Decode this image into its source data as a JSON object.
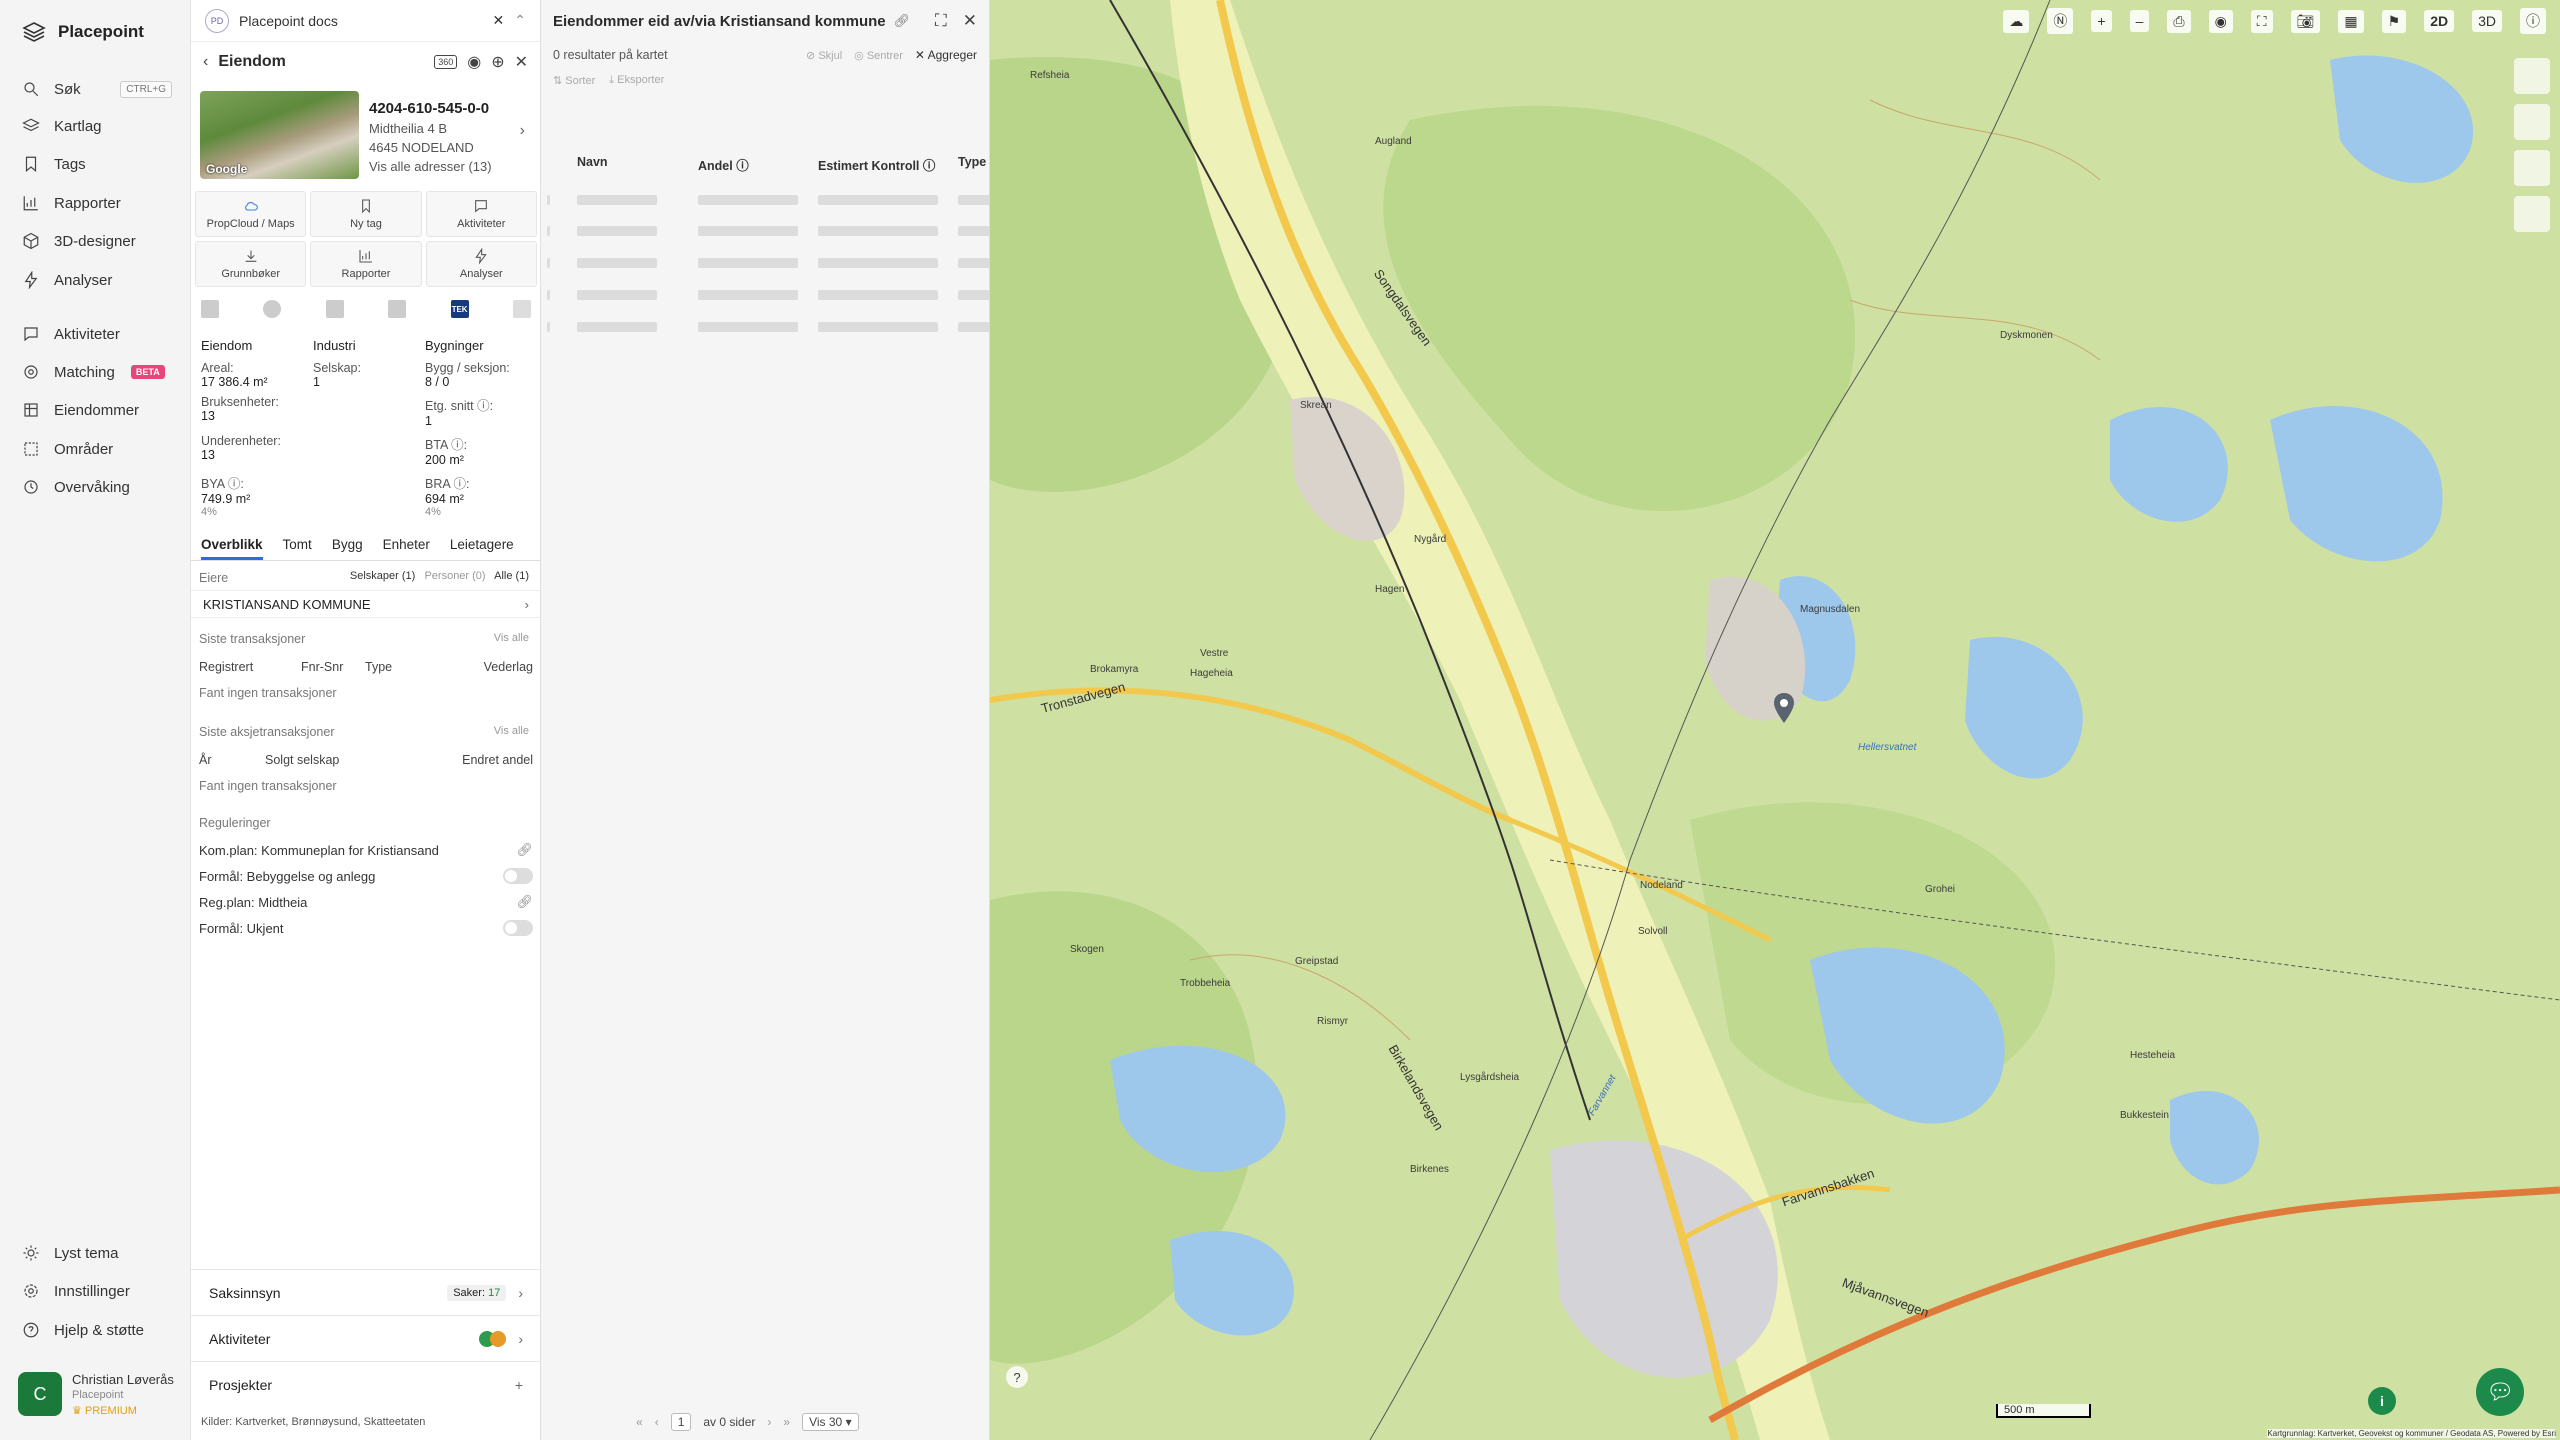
{
  "nav": {
    "brand": "Placepoint",
    "items": [
      {
        "label": "Søk",
        "icon": "search-icon",
        "kbd": "CTRL+G"
      },
      {
        "label": "Kartlag",
        "icon": "layers-icon"
      },
      {
        "label": "Tags",
        "icon": "bookmark-icon"
      },
      {
        "label": "Rapporter",
        "icon": "chart-icon"
      },
      {
        "label": "3D-designer",
        "icon": "cube-icon"
      },
      {
        "label": "Analyser",
        "icon": "bolt-icon"
      },
      {
        "label": "Aktiviteter",
        "icon": "chat-icon"
      },
      {
        "label": "Matching",
        "icon": "target-icon",
        "badge": "BETA"
      },
      {
        "label": "Eiendommer",
        "icon": "building-icon"
      },
      {
        "label": "Områder",
        "icon": "area-icon"
      },
      {
        "label": "Overvåking",
        "icon": "eye-icon"
      }
    ],
    "bottom": [
      {
        "label": "Lyst tema",
        "icon": "sun-icon"
      },
      {
        "label": "Innstillinger",
        "icon": "gear-icon"
      },
      {
        "label": "Hjelp & støtte",
        "icon": "help-icon"
      }
    ],
    "user": {
      "initial": "C",
      "name": "Christian Løverås",
      "org": "Placepoint",
      "plan": "PREMIUM"
    }
  },
  "doc": {
    "logo": "PD",
    "title": "Placepoint docs"
  },
  "property": {
    "header": "Eiendom",
    "header_badge": "360",
    "id": "4204-610-545-0-0",
    "street": "Midtheilia 4 B",
    "postal": "4645 NODELAND",
    "all_addresses": "Vis alle adresser (13)",
    "image_credit": "Google",
    "buttons": [
      "PropCloud / Maps",
      "Ny tag",
      "Aktiviteter",
      "Grunnbøker",
      "Rapporter",
      "Analyser"
    ],
    "tek_label": "TEK",
    "stats": {
      "col1_head": "Eiendom",
      "col2_head": "Industri",
      "col3_head": "Bygninger",
      "areal_label": "Areal:",
      "areal": "17 386.4 m²",
      "selskap_label": "Selskap:",
      "selskap": "1",
      "bygg_label": "Bygg / seksjon:",
      "bygg": "8 / 0",
      "bruks_label": "Bruksenheter:",
      "bruks": "13",
      "etg_label": "Etg. snitt ⓘ:",
      "etg": "1",
      "under_label": "Underenheter:",
      "under": "13",
      "bta_label": "BTA ⓘ:",
      "bta": "200 m²",
      "bya_label": "BYA ⓘ:",
      "bya": "749.9 m²",
      "bya_pct": "4%",
      "bra_label": "BRA ⓘ:",
      "bra": "694 m²",
      "bra_pct": "4%"
    },
    "tabs": [
      "Overblikk",
      "Tomt",
      "Bygg",
      "Enheter",
      "Leietagere"
    ],
    "owners_title": "Eiere",
    "owners_filters": [
      "Selskaper (1)",
      "Personer (0)",
      "Alle (1)"
    ],
    "owner": "KRISTIANSAND KOMMUNE",
    "tx_title": "Siste transaksjoner",
    "tx_viewall": "Vis alle",
    "tx_cols": [
      "Registrert",
      "Fnr-Snr",
      "Type",
      "Vederlag"
    ],
    "tx_empty": "Fant ingen transaksjoner",
    "stx_title": "Siste aksjetransaksjoner",
    "stx_viewall": "Vis alle",
    "stx_cols": [
      "År",
      "Solgt selskap",
      "Endret andel"
    ],
    "stx_empty": "Fant ingen transaksjoner",
    "reg_title": "Reguleringer",
    "regs": [
      "Kom.plan: Kommuneplan for Kristiansand",
      "Formål: Bebyggelse og anlegg",
      "Reg.plan: Midtheia",
      "Formål: Ukjent"
    ],
    "saksinnsyn": "Saksinnsyn",
    "saker_label": "Saker:",
    "saker": "17",
    "aktiviteter": "Aktiviteter",
    "prosjekter": "Prosjekter",
    "kilder_label": "Kilder:",
    "kilder": [
      "Kartverket,",
      "Brønnøysund,",
      "Skatteetaten"
    ]
  },
  "list": {
    "title": "Eiendommer eid av/via Kristiansand kommune",
    "results": "0 resultater på kartet",
    "hide": "Skjul",
    "center": "Sentrer",
    "aggregate": "Aggreger",
    "sort": "Sorter",
    "export": "Eksporter",
    "columns": [
      "Navn",
      "Andel ⓘ",
      "Estimert Kontroll ⓘ",
      "Type"
    ],
    "page": "1",
    "of_pages": "av 0 sider",
    "per_page": "Vis 30"
  },
  "map": {
    "topbar": [
      "2D",
      "3D"
    ],
    "scale": "500 m",
    "attribution": "Kartgrunnlag: Kartverket, Geovekst og kommuner / Geodata AS, Powered by Esri",
    "labels": {
      "songdalsvegen": "Songdalsvegen",
      "tronstadvegen": "Tronstadvegen",
      "birkelandsvegen": "Birkelandsvegen",
      "farvannsbakken": "Farvannsbakken",
      "mjavannsvegen": "Mjåvannsvegen",
      "nodeland": "Nodeland",
      "hagen": "Hagen",
      "skrean": "Skrean",
      "nygard": "Nygård",
      "solvoll": "Solvoll",
      "greipstad": "Greipstad",
      "rismyr": "Rismyr",
      "refsheia": "Refsheia",
      "augland": "Augland",
      "farvannet": "Farvannet",
      "hellersvatnet": "Hellersvatnet",
      "dyskmonen": "Dyskmonen",
      "brokamyra": "Brokamyra",
      "hageheia": "Hageheia",
      "vestre": "Vestre",
      "magnusdalen": "Magnusdalen",
      "skogen": "Skogen",
      "trobbeheia": "Trobbeheia",
      "lysgardsheia": "Lysgårdsheia",
      "birkenes": "Birkenes",
      "grohei": "Grohei",
      "bukkestein": "Bukkestein",
      "hestheia": "Hesteheia"
    }
  }
}
